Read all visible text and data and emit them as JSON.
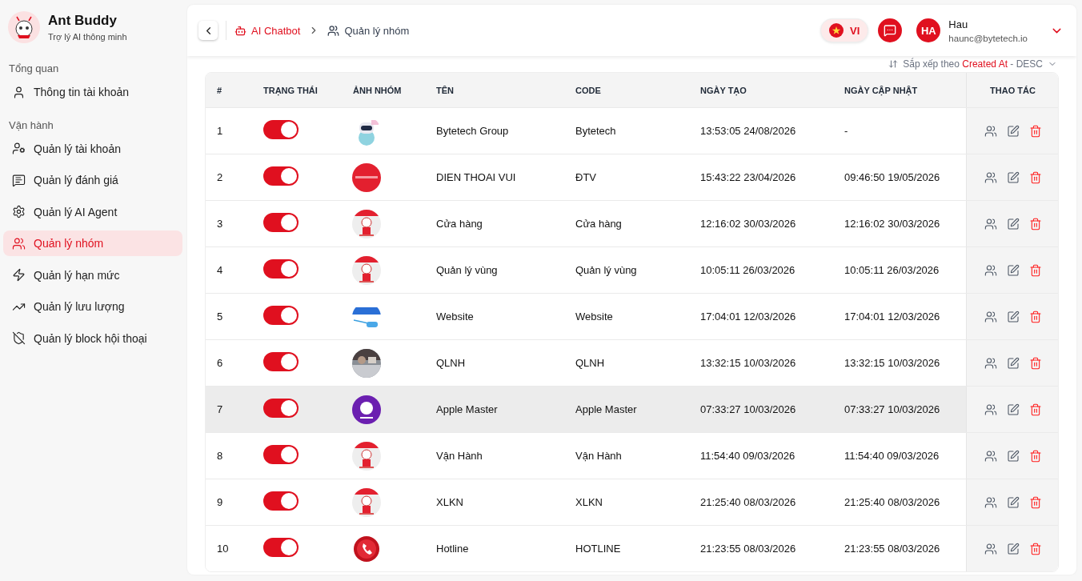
{
  "brand": {
    "name": "Ant Buddy",
    "tagline": "Trợ lý AI thông minh"
  },
  "sidebar": {
    "sections": [
      {
        "title": "Tổng quan",
        "items": [
          {
            "label": "Thông tin tài khoản",
            "selected": false
          }
        ]
      },
      {
        "title": "Vận hành",
        "items": [
          {
            "label": "Quản lý tài khoản",
            "selected": false
          },
          {
            "label": "Quản lý đánh giá",
            "selected": false
          },
          {
            "label": "Quản lý AI Agent",
            "selected": false
          },
          {
            "label": "Quản lý nhóm",
            "selected": true
          },
          {
            "label": "Quản lý hạn mức",
            "selected": false
          },
          {
            "label": "Quản lý lưu lượng",
            "selected": false
          },
          {
            "label": "Quản lý block hội thoại",
            "selected": false
          }
        ]
      }
    ]
  },
  "breadcrumb": [
    {
      "label": "AI Chatbot"
    },
    {
      "label": "Quản lý nhóm"
    }
  ],
  "header": {
    "language": "VI",
    "user": {
      "initials": "HA",
      "name": "Hau",
      "email": "haunc@bytetech.io"
    }
  },
  "sort": {
    "prefix": "Sắp xếp theo",
    "field": "Created At",
    "suffix": "- DESC"
  },
  "table": {
    "columns": [
      "#",
      "TRẠNG THÁI",
      "ẢNH NHÓM",
      "TÊN",
      "CODE",
      "NGÀY TẠO",
      "NGÀY CẬP NHẬT",
      "THAO TÁC"
    ],
    "rows": [
      {
        "index": "1",
        "on": true,
        "name": "Bytetech Group",
        "code": "Bytetech",
        "created": "13:53:05 24/08/2026",
        "updated": "-",
        "selected": false
      },
      {
        "index": "2",
        "on": true,
        "name": "DIEN THOAI VUI",
        "code": "ĐTV",
        "created": "15:43:22 23/04/2026",
        "updated": "09:46:50 19/05/2026",
        "selected": false
      },
      {
        "index": "3",
        "on": true,
        "name": "Cửa hàng",
        "code": "Cửa hàng",
        "created": "12:16:02 30/03/2026",
        "updated": "12:16:02 30/03/2026",
        "selected": false
      },
      {
        "index": "4",
        "on": true,
        "name": "Quản lý vùng",
        "code": "Quản lý vùng",
        "created": "10:05:11 26/03/2026",
        "updated": "10:05:11 26/03/2026",
        "selected": false
      },
      {
        "index": "5",
        "on": true,
        "name": "Website",
        "code": "Website",
        "created": "17:04:01 12/03/2026",
        "updated": "17:04:01 12/03/2026",
        "selected": false
      },
      {
        "index": "6",
        "on": true,
        "name": "QLNH",
        "code": "QLNH",
        "created": "13:32:15 10/03/2026",
        "updated": "13:32:15 10/03/2026",
        "selected": false
      },
      {
        "index": "7",
        "on": true,
        "name": "Apple Master",
        "code": "Apple Master",
        "created": "07:33:27 10/03/2026",
        "updated": "07:33:27 10/03/2026",
        "selected": true
      },
      {
        "index": "8",
        "on": true,
        "name": "Vận Hành",
        "code": "Vận Hành",
        "created": "11:54:40 09/03/2026",
        "updated": "11:54:40 09/03/2026",
        "selected": false
      },
      {
        "index": "9",
        "on": true,
        "name": "XLKN",
        "code": "XLKN",
        "created": "21:25:40 08/03/2026",
        "updated": "21:25:40 08/03/2026",
        "selected": false
      },
      {
        "index": "10",
        "on": true,
        "name": "Hotline",
        "code": "HOTLINE",
        "created": "21:23:55 08/03/2026",
        "updated": "21:23:55 08/03/2026",
        "selected": false
      }
    ]
  }
}
